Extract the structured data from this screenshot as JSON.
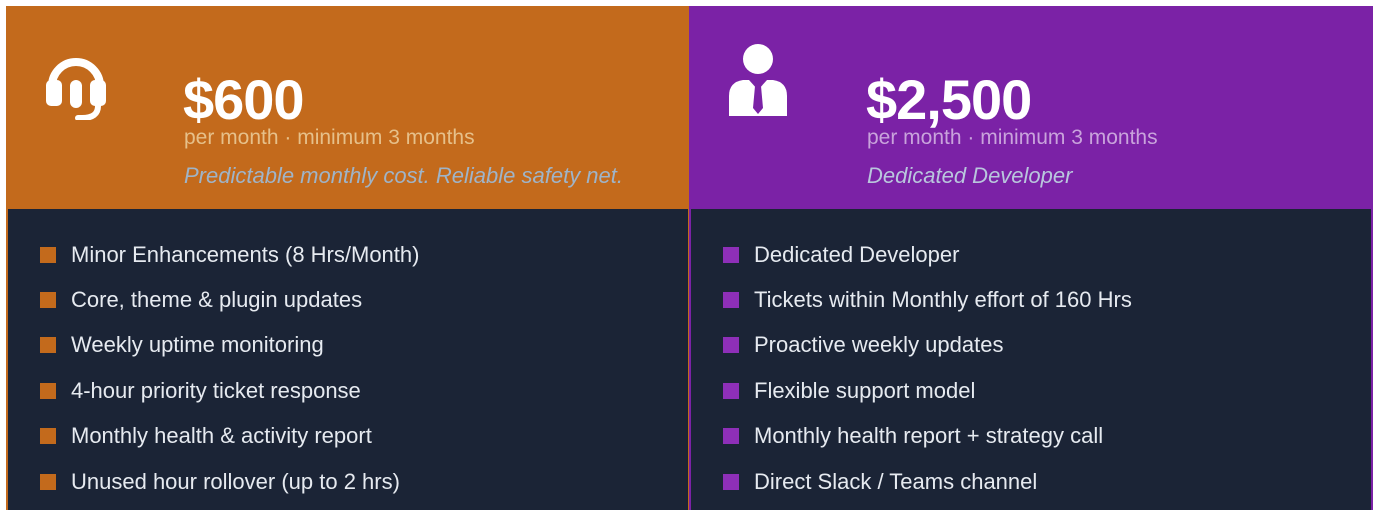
{
  "colors": {
    "orange_accent": "#c36a1c",
    "purple_accent": "#7b22a6",
    "panel_bg": "#1b2436"
  },
  "plans": [
    {
      "icon": "headset-icon",
      "price": "$600",
      "period": "per month · minimum 3 months",
      "tagline": "Predictable monthly cost. Reliable safety net.",
      "features": [
        "Minor Enhancements (8 Hrs/Month)",
        "Core, theme & plugin updates",
        "Weekly uptime monitoring",
        "4-hour priority ticket response",
        "Monthly health & activity report",
        "Unused hour rollover (up to 2 hrs)"
      ]
    },
    {
      "icon": "developer-person-icon",
      "price": "$2,500",
      "period": "per month · minimum 3 months",
      "tagline": "Dedicated Developer",
      "features": [
        "Dedicated Developer",
        "Tickets within Monthly effort of 160 Hrs",
        "Proactive weekly updates",
        "Flexible support model",
        "Monthly health report + strategy call",
        "Direct Slack / Teams channel"
      ]
    }
  ]
}
